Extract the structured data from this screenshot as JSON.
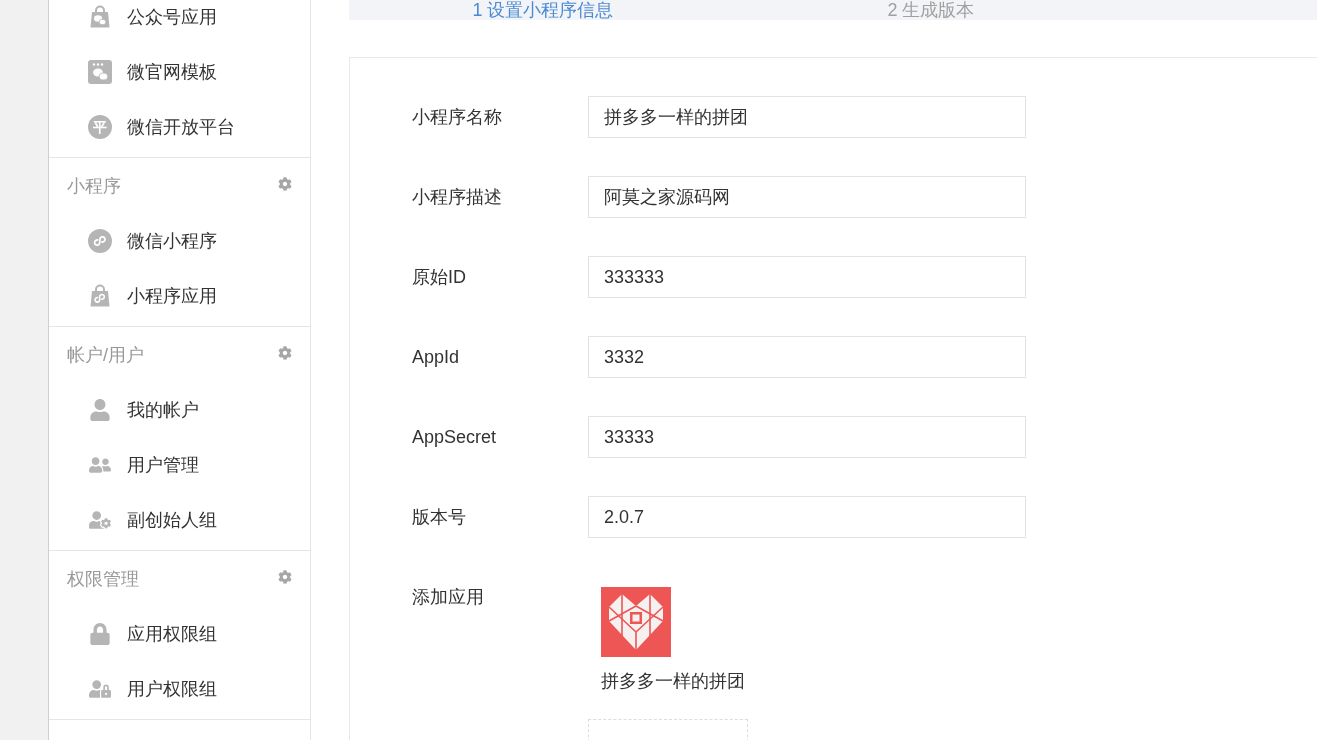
{
  "sidebar": {
    "sections": [
      {
        "items": [
          {
            "label": "公众号应用",
            "kind": "bag"
          },
          {
            "label": "微官网模板",
            "kind": "chat"
          },
          {
            "label": "微信开放平台",
            "kind": "glyph",
            "glyph": "平"
          }
        ]
      },
      {
        "title": "小程序",
        "items": [
          {
            "label": "微信小程序",
            "kind": "mini"
          },
          {
            "label": "小程序应用",
            "kind": "bagmini"
          }
        ]
      },
      {
        "title": "帐户/用户",
        "items": [
          {
            "label": "我的帐户",
            "kind": "person"
          },
          {
            "label": "用户管理",
            "kind": "people"
          },
          {
            "label": "副创始人组",
            "kind": "persongear"
          }
        ]
      },
      {
        "title": "权限管理",
        "items": [
          {
            "label": "应用权限组",
            "kind": "lock"
          },
          {
            "label": "用户权限组",
            "kind": "personlock"
          }
        ]
      }
    ]
  },
  "steps": [
    {
      "label": "1 设置小程序信息",
      "selected": true
    },
    {
      "label": "2 生成版本",
      "selected": false
    }
  ],
  "form": {
    "fields": [
      {
        "label": "小程序名称",
        "value": "拼多多一样的拼团"
      },
      {
        "label": "小程序描述",
        "value": "阿莫之家源码网"
      },
      {
        "label": "原始ID",
        "value": "333333"
      },
      {
        "label": "AppId",
        "value": "3332"
      },
      {
        "label": "AppSecret",
        "value": "33333"
      },
      {
        "label": "版本号",
        "value": "2.0.7"
      }
    ],
    "apps_label": "添加应用",
    "apps": [
      {
        "name": "拼多多一样的拼团"
      }
    ]
  }
}
